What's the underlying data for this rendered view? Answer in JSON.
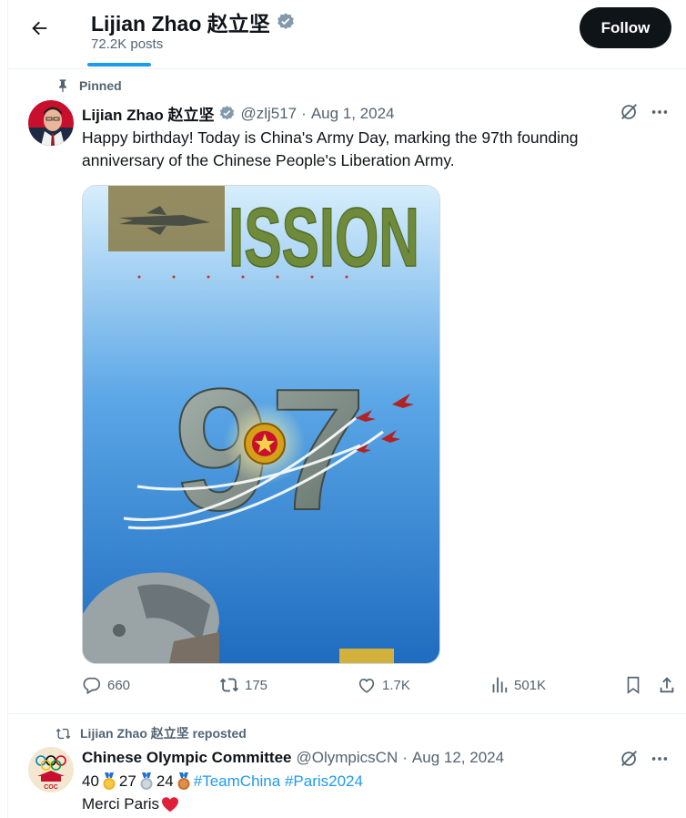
{
  "header": {
    "title": "Lijian Zhao 赵立坚",
    "posts_count": "72.2K posts",
    "follow_label": "Follow"
  },
  "pinned_post": {
    "social_context": "Pinned",
    "author_name": "Lijian Zhao 赵立坚",
    "handle": "@zlj517",
    "separator": "·",
    "date": "Aug 1, 2024",
    "text": "Happy birthday! Today is China's Army Day, marking the 97th founding anniversary of the Chinese People's Liberation Army.",
    "image": {
      "headline": "ISSION",
      "number": "97",
      "colors": {
        "sky_top": "#cfe9fb",
        "sky_bottom": "#2a78c8",
        "title_green": "#6f8a3a"
      }
    },
    "actions": {
      "replies": "660",
      "reposts": "175",
      "likes": "1.7K",
      "views": "501K"
    }
  },
  "repost": {
    "social_context": "Lijian Zhao 赵立坚 reposted",
    "author_name": "Chinese Olympic Committee",
    "handle": "@OlympicsCN",
    "separator": "·",
    "date": "Aug 12, 2024",
    "gold_count": "40",
    "silver_count": "27",
    "bronze_count": "24",
    "hashtag_1": "#TeamChina",
    "hashtag_2": "#Paris2024",
    "line2": "Merci Paris",
    "avatar_label": "COC"
  },
  "colors": {
    "accent": "#1d9bf0",
    "verified": "#829aab",
    "text_primary": "#0f1419",
    "text_secondary": "#536471"
  }
}
